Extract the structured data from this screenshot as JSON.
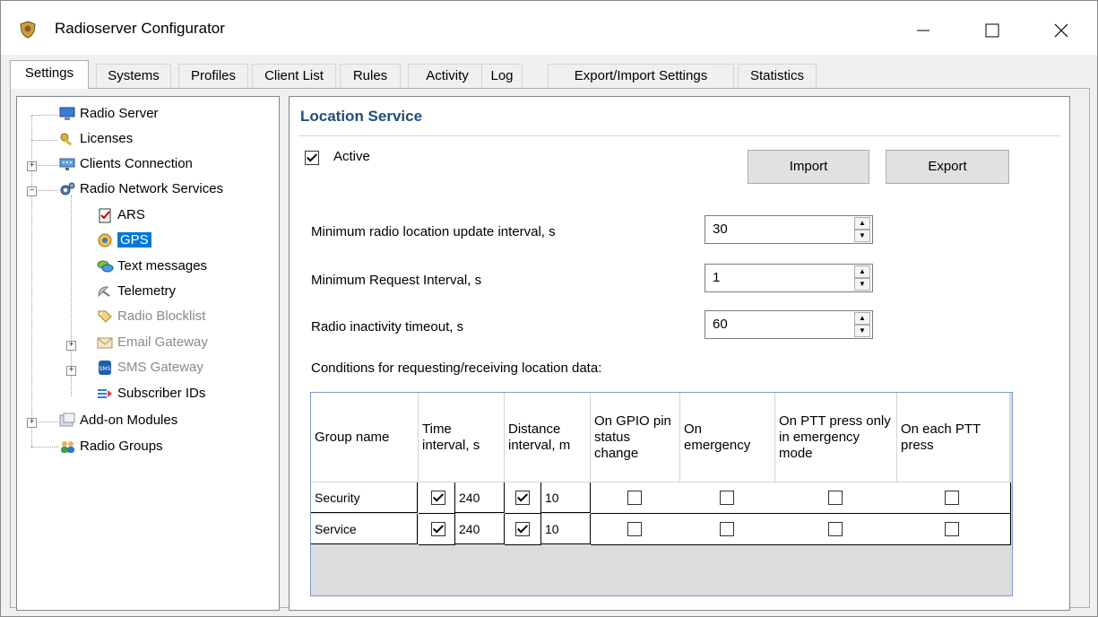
{
  "window": {
    "title": "Radioserver Configurator"
  },
  "tabs": [
    "Settings",
    "Systems",
    "Profiles",
    "Client List",
    "Rules",
    "Activity",
    "Log",
    "Export/Import Settings",
    "Statistics"
  ],
  "tree": {
    "radio_server": "Radio Server",
    "licenses": "Licenses",
    "clients_connection": "Clients Connection",
    "radio_network_services": "Radio Network Services",
    "ars": "ARS",
    "gps": "GPS",
    "text_messages": "Text messages",
    "telemetry": "Telemetry",
    "radio_blocklist": "Radio Blocklist",
    "email_gateway": "Email Gateway",
    "sms_gateway": "SMS Gateway",
    "subscriber_ids": "Subscriber IDs",
    "addon_modules": "Add-on Modules",
    "radio_groups": "Radio Groups"
  },
  "panel": {
    "title": "Location Service",
    "active_label": "Active",
    "active_checked": true,
    "import_label": "Import",
    "export_label": "Export",
    "fields": [
      {
        "label": "Minimum radio location update interval, s",
        "value": "30"
      },
      {
        "label": "Minimum Request Interval, s",
        "value": "1"
      },
      {
        "label": "Radio inactivity timeout, s",
        "value": "60"
      }
    ],
    "conditions_label": "Conditions for requesting/receiving location data:"
  },
  "table": {
    "headers": {
      "group_name": "Group name",
      "time_interval": "Time interval, s",
      "distance_interval": "Distance interval, m",
      "gpio": "On GPIO pin status change",
      "emergency": "On emergency",
      "ptt_emergency": "On PTT press only in emergency mode",
      "each_ptt": "On each PTT press"
    },
    "rows": [
      {
        "group": "Security",
        "time_on": true,
        "time": "240",
        "dist_on": true,
        "dist": "10",
        "gpio": false,
        "emergency": false,
        "ptt_emergency": false,
        "each_ptt": false
      },
      {
        "group": "Service",
        "time_on": true,
        "time": "240",
        "dist_on": true,
        "dist": "10",
        "gpio": false,
        "emergency": false,
        "ptt_emergency": false,
        "each_ptt": false
      }
    ]
  }
}
